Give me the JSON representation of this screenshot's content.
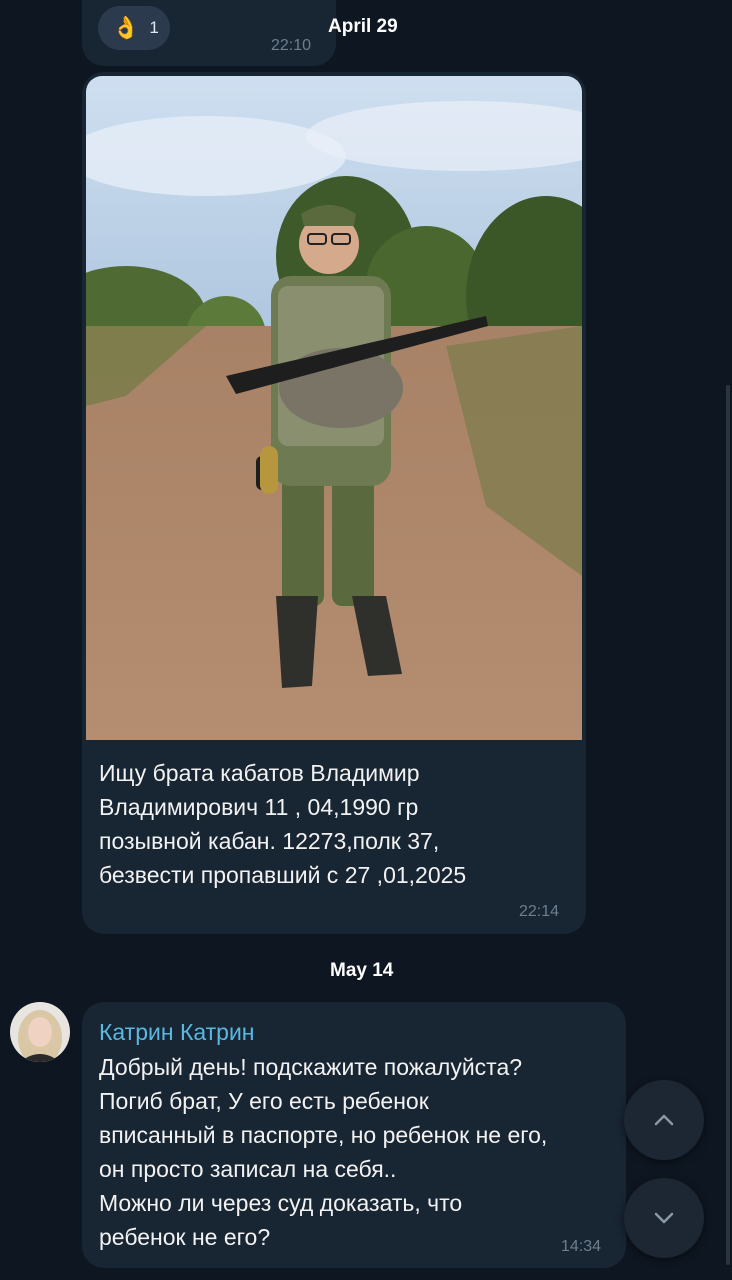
{
  "messages": {
    "prev": {
      "reaction_icon": "ok-hand-icon",
      "reaction_emoji": "👌",
      "reaction_count": "1",
      "time": "22:10"
    },
    "date1": "April 29",
    "photo_message": {
      "image": "soldier-photo",
      "text": "Ищу брата кабатов Владимир\nВладимирович 11 , 04,1990 гр\nпозывной кабан. 12273,полк 37,\nбезвести пропавший с 27 ,01,2025",
      "time": "22:14"
    },
    "date2": "May 14",
    "katrin_message": {
      "sender": "Катрин Катрин",
      "text": "Добрый день! подскажите пожалуйста?\nПогиб брат, У его есть ребенок\nвписанный в паспорте, но ребенок не его,\nон просто записал на себя..\nМожно ли через суд доказать, что\nребенок не его?",
      "time": "14:34"
    }
  },
  "controls": {
    "scroll_up_icon": "chevron-up-icon",
    "scroll_down_icon": "chevron-down-icon"
  },
  "colors": {
    "background": "#0e1621",
    "bubble": "#182533",
    "sender_name": "#5ab7e0",
    "timestamp": "#6d7f8f"
  }
}
